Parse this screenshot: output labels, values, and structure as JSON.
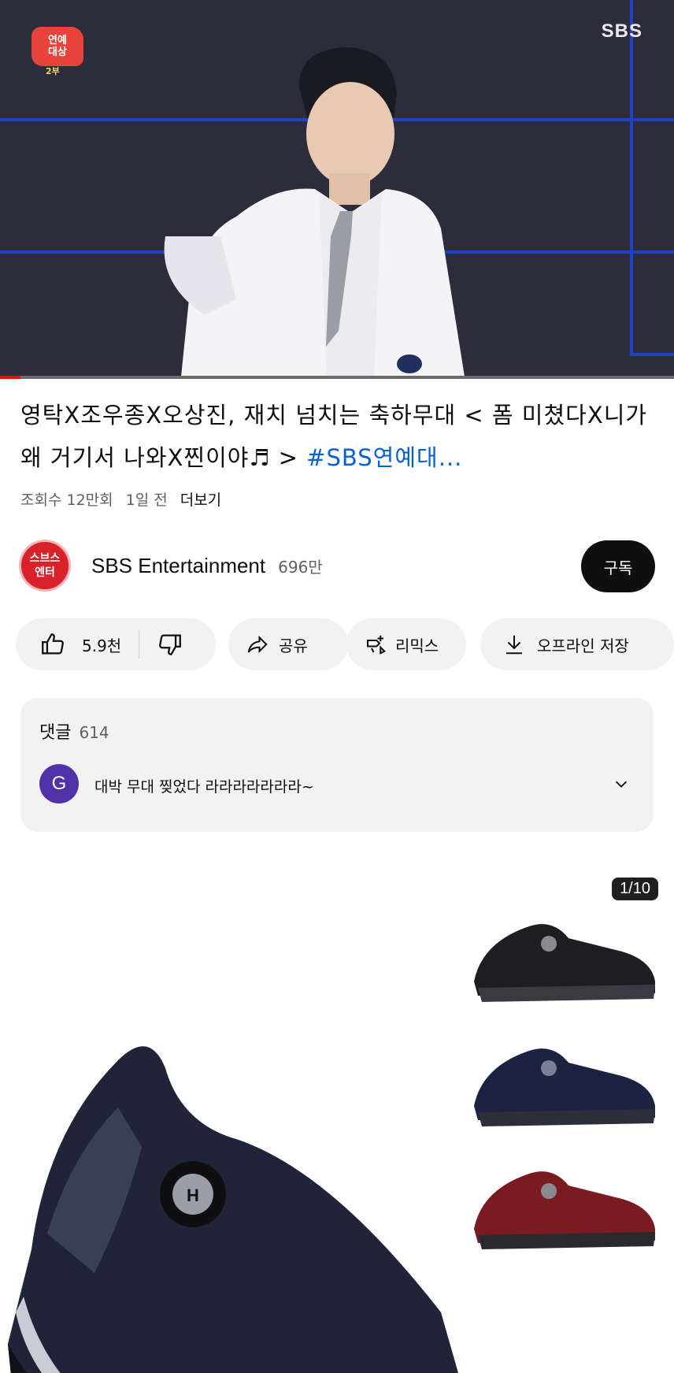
{
  "player": {
    "show_logo_line1": "연예",
    "show_logo_line2": "대상",
    "show_logo_sub": "2부",
    "network_logo": "SBS",
    "progress_fraction": 0.03
  },
  "video": {
    "title_main": "영탁X조우종X오상진, 재치 넘치는  축하무대 < 폼 미쳤다X니가 왜 거기서 나와X찐이야♬ > ",
    "title_hashtag": "#SBS연예대...",
    "views": "조회수 12만회",
    "age": "1일 전",
    "more": "더보기"
  },
  "channel": {
    "avatar_line1": "스브스",
    "avatar_line2": "엔터",
    "name": "SBS Entertainment",
    "subscribers": "696만",
    "subscribe_label": "구독"
  },
  "actions": {
    "like_count": "5.9천",
    "share_label": "공유",
    "remix_label": "리믹스",
    "download_label": "오프라인 저장"
  },
  "comments": {
    "label": "댓글",
    "count": "614",
    "top_avatar_letter": "G",
    "top_comment": "대박 무대 찢었다 라라라라라라라~"
  },
  "ad": {
    "counter": "1/10"
  },
  "colors": {
    "accent_link": "#065fd4",
    "progress": "#ff0000",
    "stage_blue": "#2340c9"
  }
}
